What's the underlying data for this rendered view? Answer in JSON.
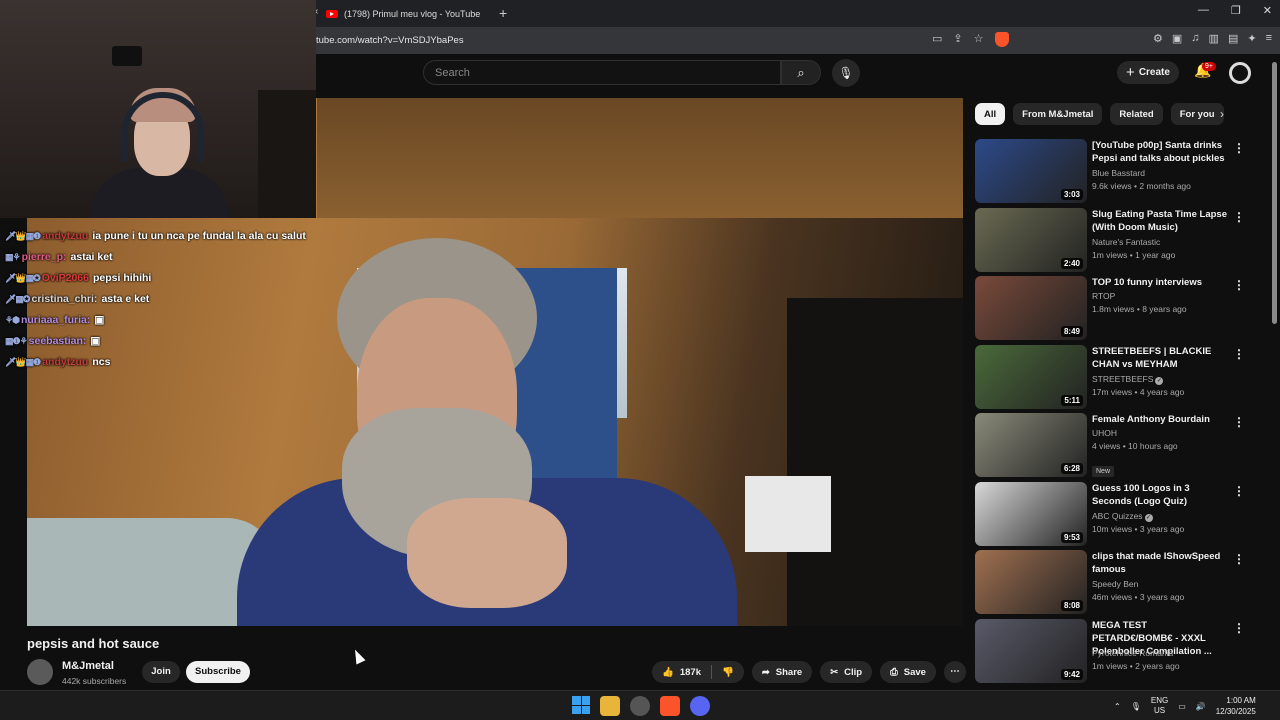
{
  "browser": {
    "tab_title": "(1798) Primul meu vlog - YouTube",
    "new_tab": "+",
    "tab_back": "‹",
    "url": "tube.com/watch?v=VmSDJYbaPes",
    "win_min": "—",
    "win_max": "❐",
    "win_close": "✕"
  },
  "youtube_header": {
    "search_placeholder": "Search",
    "search_icon": "⌕",
    "mic_icon": "🎙",
    "create_plus": "+",
    "create_label": "Create",
    "bell_icon": "🔔",
    "notification_count": "9+"
  },
  "chat": [
    {
      "badges": "🗡👑▦❶",
      "user": "andytzuu",
      "user_color": "#c23a3a",
      "message": "ia pune i tu un nca pe fundal la ala cu salut"
    },
    {
      "badges": "▦⚘",
      "user": "pierre_p:",
      "user_color": "#e05a8a",
      "message": "astai ket"
    },
    {
      "badges": "🗡👑▦✪",
      "user": "OviP2066",
      "user_color": "#e03a3a",
      "message": "pepsi hihihi"
    },
    {
      "badges": "🗡▦✪",
      "user": "cristina_chri:",
      "user_color": "#d8d8d8",
      "message": "asta e ket"
    },
    {
      "badges": "⚘⬢",
      "user": "nuriaaa_furia:",
      "user_color": "#b48ae0",
      "message": "▣"
    },
    {
      "badges": "▦❶⚘",
      "user": "seebastian:",
      "user_color": "#b48ae0",
      "message": "▣"
    },
    {
      "badges": "🗡👑▦❶",
      "user": "andytzuu",
      "user_color": "#c23a3a",
      "message": "ncs"
    }
  ],
  "video": {
    "title": "pepsis and hot sauce",
    "channel_name": "M&Jmetal",
    "subscribers": "442k subscribers",
    "join_label": "Join",
    "subscribe_label": "Subscribe",
    "likes": "187k",
    "like_icon": "👍",
    "dislike_icon": "👎",
    "share_icon": "➦",
    "share_label": "Share",
    "clip_icon": "✂",
    "clip_label": "Clip",
    "save_icon": "⎙",
    "save_label": "Save",
    "more_icon": "⋯"
  },
  "chips": [
    "All",
    "From M&Jmetal",
    "Related",
    "For you"
  ],
  "chip_next": "›",
  "recommendations": [
    {
      "title": "[YouTube p00p] Santa drinks Pepsi and talks about pickles",
      "channel": "Blue Basstard",
      "verified": false,
      "meta": "9.6k views • 2 months ago",
      "duration": "3:03",
      "thumb_color": "#2c4a8a",
      "is_new": false
    },
    {
      "title": "Slug Eating Pasta Time Lapse (With Doom Music)",
      "channel": "Nature's Fantastic",
      "verified": false,
      "meta": "1m views • 1 year ago",
      "duration": "2:40",
      "thumb_color": "#6a6a52",
      "is_new": false
    },
    {
      "title": "TOP 10 funny interviews",
      "channel": "RTOP",
      "verified": false,
      "meta": "1.8m views • 8 years ago",
      "duration": "8:49",
      "thumb_color": "#7a4a3a",
      "is_new": false
    },
    {
      "title": "STREETBEEFS | BLACKIE CHAN vs MEYHAM",
      "channel": "STREETBEEFS",
      "verified": true,
      "meta": "17m views • 4 years ago",
      "duration": "5:11",
      "thumb_color": "#4a6a3a",
      "is_new": false
    },
    {
      "title": "Female Anthony Bourdain",
      "channel": "UHOH",
      "verified": false,
      "meta": "4 views • 10 hours ago",
      "duration": "6:28",
      "thumb_color": "#8a8a7a",
      "is_new": true,
      "new_label": "New"
    },
    {
      "title": "Guess 100 Logos in 3 Seconds (Logo Quiz)",
      "channel": "ABC Quizzes",
      "verified": true,
      "meta": "10m views • 3 years ago",
      "duration": "9:53",
      "thumb_color": "#d8d8d8",
      "is_new": false
    },
    {
      "title": "clips that made IShowSpeed famous",
      "channel": "Speedy Ben",
      "verified": false,
      "meta": "46m views • 3 years ago",
      "duration": "8:08",
      "thumb_color": "#a07050",
      "is_new": false
    },
    {
      "title": "MEGA TEST PETARD€/BOMB€ - XXXL Polenboller Compilation ...",
      "channel": "Pyrotehnice Romania",
      "verified": false,
      "meta": "1m views • 2 years ago",
      "duration": "9:42",
      "thumb_color": "#5a5a6a",
      "is_new": false
    }
  ],
  "taskbar": {
    "lang_top": "ENG",
    "lang_bottom": "US",
    "time": "1:00 AM",
    "date": "12/30/2025",
    "tray_up": "⌃",
    "mic_icon": "🎙",
    "net_icon": "▭",
    "vol_icon": "🔊"
  },
  "colors": {
    "background": "#0f0f0f",
    "youtube_red": "#ff0000",
    "chip_active": "#f1f1f1"
  }
}
